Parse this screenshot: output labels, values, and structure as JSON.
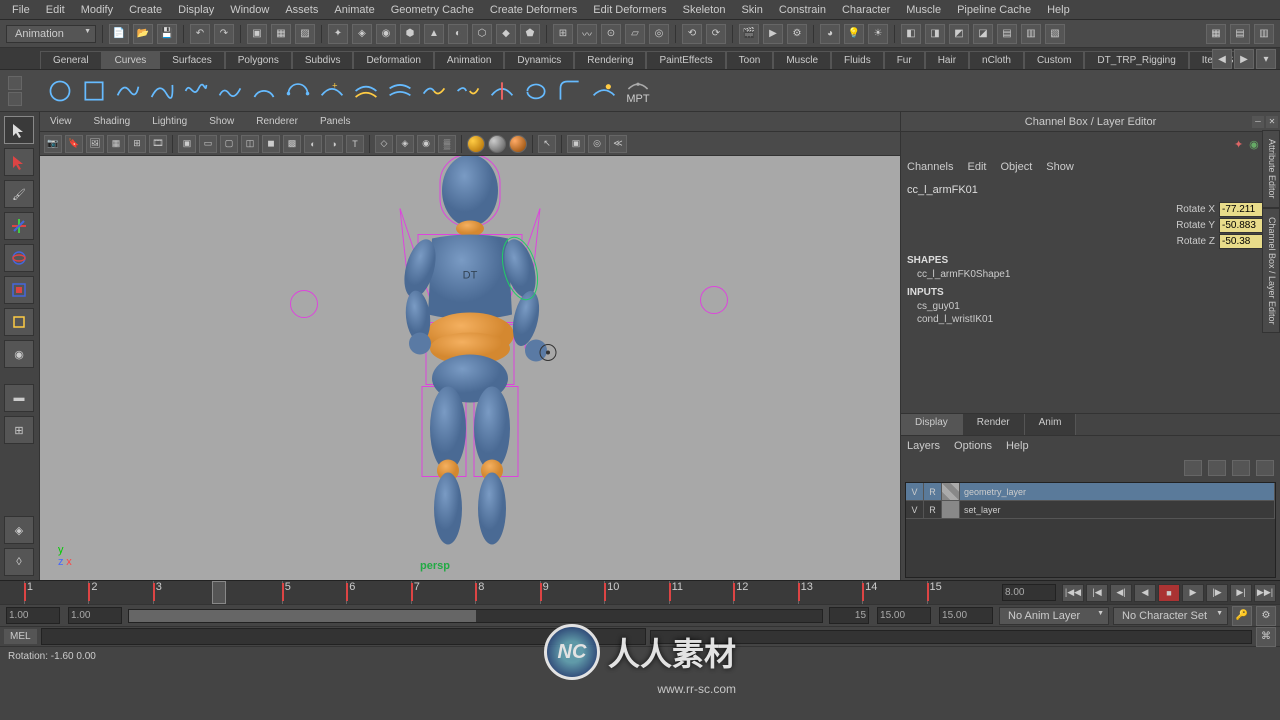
{
  "menubar": [
    "File",
    "Edit",
    "Modify",
    "Create",
    "Display",
    "Window",
    "Assets",
    "Animate",
    "Geometry Cache",
    "Create Deformers",
    "Edit Deformers",
    "Skeleton",
    "Skin",
    "Constrain",
    "Character",
    "Muscle",
    "Pipeline Cache",
    "Help"
  ],
  "mode_dropdown": "Animation",
  "shelf_tabs": [
    "General",
    "Curves",
    "Surfaces",
    "Polygons",
    "Subdivs",
    "Deformation",
    "Animation",
    "Dynamics",
    "Rendering",
    "PaintEffects",
    "Toon",
    "Muscle",
    "Fluids",
    "Fur",
    "Hair",
    "nCloth",
    "Custom",
    "DT_TRP_Rigging",
    "Item_S"
  ],
  "shelf_active": 1,
  "mpt_label": "MPT",
  "vp_menus": [
    "View",
    "Shading",
    "Lighting",
    "Show",
    "Renderer",
    "Panels"
  ],
  "persp_label": "persp",
  "channel_box": {
    "title": "Channel Box / Layer Editor",
    "menus": [
      "Channels",
      "Edit",
      "Object",
      "Show"
    ],
    "object": "cc_l_armFK01",
    "attrs": [
      {
        "label": "Rotate X",
        "value": "-77.211"
      },
      {
        "label": "Rotate Y",
        "value": "-50.883"
      },
      {
        "label": "Rotate Z",
        "value": "-50.38"
      }
    ],
    "shapes_hdr": "SHAPES",
    "shapes": [
      "cc_l_armFK0Shape1"
    ],
    "inputs_hdr": "INPUTS",
    "inputs": [
      "cs_guy01",
      "cond_l_wristIK01"
    ]
  },
  "side_tabs": [
    "Attribute Editor",
    "Channel Box / Layer Editor"
  ],
  "layer_panel": {
    "tabs": [
      "Display",
      "Render",
      "Anim"
    ],
    "active": 0,
    "menus": [
      "Layers",
      "Options",
      "Help"
    ],
    "layers": [
      {
        "v": "V",
        "r": "R",
        "name": "geometry_layer",
        "sel": true
      },
      {
        "v": "V",
        "r": "R",
        "name": "set_layer",
        "sel": false
      }
    ]
  },
  "timeline": {
    "ticks": [
      "1",
      "2",
      "3",
      "4",
      "5",
      "6",
      "7",
      "8",
      "9",
      "10",
      "11",
      "12",
      "13",
      "14",
      "15"
    ],
    "current": 4,
    "keys": [
      1,
      2,
      3,
      4,
      5,
      6,
      7,
      8,
      9,
      10,
      11,
      12,
      13,
      14,
      15
    ],
    "field": "8.00"
  },
  "range": {
    "start": "1.00",
    "in_start": "1.00",
    "in_end": "15",
    "end": "15.00",
    "out": "15.00",
    "anim_layer": "No Anim Layer",
    "char_set": "No Character Set"
  },
  "cmd": {
    "lang": "MEL"
  },
  "status": "Rotation:    -1.60    0.00",
  "watermark": {
    "text": "人人素材",
    "url": "www.rr-sc.com",
    "logo": "NC"
  },
  "chest_label": "DT"
}
